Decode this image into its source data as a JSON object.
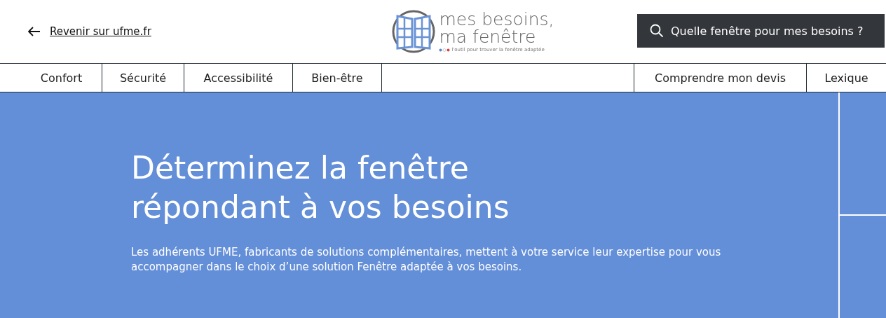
{
  "header": {
    "back_link": "Revenir sur ufme.fr",
    "logo": {
      "line_1": "mes besoins,",
      "line_2": "ma fenêtre",
      "tagline": "l'outil pour trouver la fenêtre adaptée"
    },
    "search_button": "Quelle fenêtre pour mes besoins ?"
  },
  "nav": {
    "left": [
      {
        "label": "Confort"
      },
      {
        "label": "Sécurité"
      },
      {
        "label": "Accessibilité"
      },
      {
        "label": "Bien-être"
      }
    ],
    "right": [
      {
        "label": "Comprendre mon devis"
      },
      {
        "label": "Lexique"
      }
    ]
  },
  "hero": {
    "title_line_1": "Déterminez la fenêtre",
    "title_line_2": "répondant à vos besoins",
    "text": "Les adhérents UFME, fabricants de solutions complémentaires, mettent à votre service leur expertise pour vous accompagner dans le choix d’une solution Fenêtre adaptée à vos besoins."
  }
}
